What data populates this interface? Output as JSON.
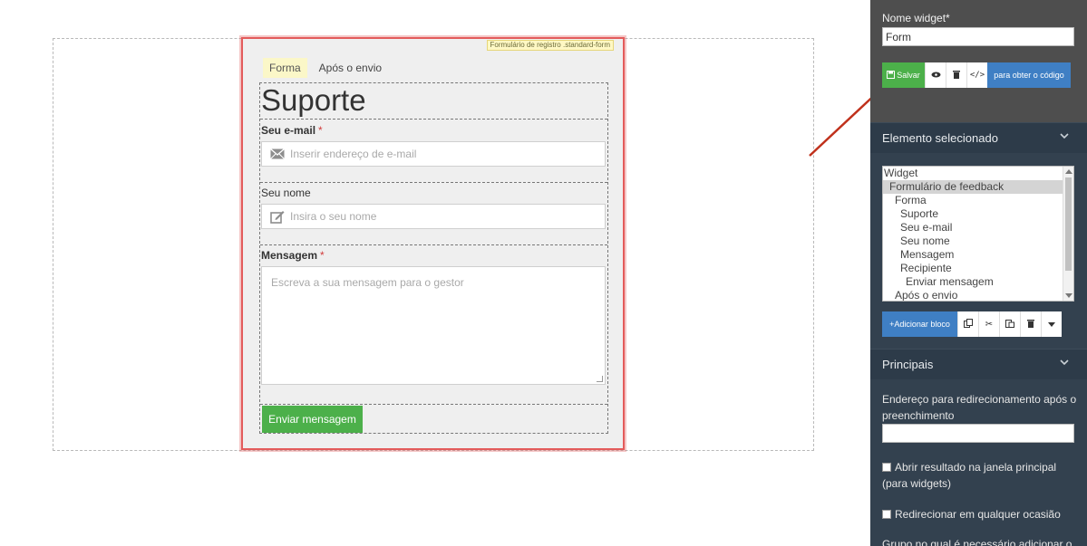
{
  "form_preview": {
    "frame_tag": "Formulário de registro .standard-form",
    "tabs": [
      "Forma",
      "Após o envio"
    ],
    "heading": "Suporte",
    "email": {
      "label": "Seu e-mail",
      "required": "*",
      "placeholder": "Inserir endereço de e-mail",
      "icon": "envelope-icon"
    },
    "name": {
      "label": "Seu nome",
      "placeholder": "Insira o seu nome",
      "icon": "pencil-icon"
    },
    "message": {
      "label": "Mensagem",
      "required": "*",
      "placeholder": "Escreva a sua mensagem para o gestor"
    },
    "submit_label": "Enviar mensagem"
  },
  "panel": {
    "widget_name_label": "Nome widget*",
    "widget_name_value": "Form",
    "toolbar": {
      "save_label": "Salvar",
      "code_label": "para obter o código",
      "icons": [
        "save-icon",
        "eye-icon",
        "trash-icon",
        "code-icon"
      ]
    },
    "selected_section_title": "Elemento selecionado",
    "tree_items": [
      "Widget",
      "Formulário de feedback",
      "Forma",
      "Suporte",
      "Seu e-mail",
      "Seu nome",
      "Mensagem",
      "Recipiente",
      "Enviar mensagem",
      "Após o envio"
    ],
    "tree_selected_index": 1,
    "block_toolbar": {
      "add_label": "+Adicionar bloco",
      "icons": [
        "copy-icon",
        "scissors-icon",
        "paste-icon",
        "trash-icon",
        "caret-down-icon"
      ]
    },
    "principais_title": "Principais",
    "redirect_label": "Endereço para redirecionamento após o preenchimento",
    "redirect_value": "",
    "check_open_main": "Abrir resultado na janela principal (para widgets)",
    "check_redirect_any": "Redirecionar em qualquer ocasião",
    "group_label": "Grupo no qual é necessário adicionar o"
  },
  "colors": {
    "frame_border": "#e35b5b",
    "submit_green": "#4cb04a",
    "save_green": "#4cb04a",
    "primary_blue": "#3f7fc4",
    "panel_bg": "#33414f",
    "panel_top_bg": "#4e4e4e",
    "arrow_red": "#c0311c"
  }
}
